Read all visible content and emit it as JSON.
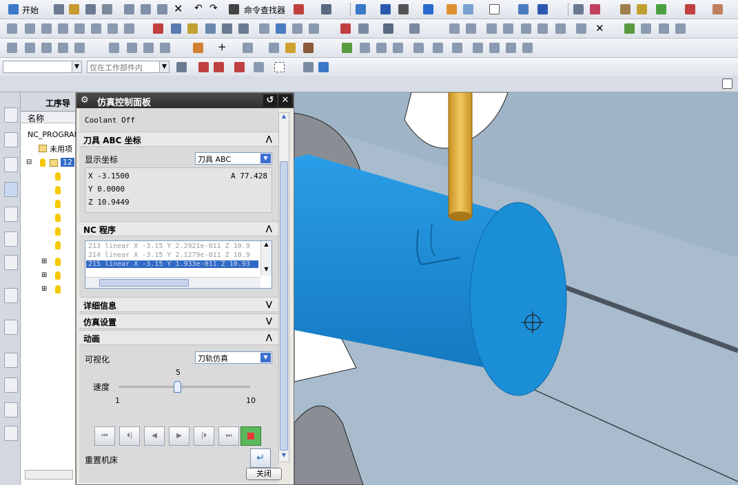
{
  "toolbar": {
    "start_label": "开始",
    "command_finder_label": "命令查找器"
  },
  "filters": {
    "filter_placeholder": "",
    "scope_label": "仅在工作部件内"
  },
  "navigator": {
    "title": "工序导",
    "column_name": "名称",
    "program_root": "NC_PROGRAM",
    "unused_item": "未用项",
    "program_item": "12"
  },
  "sim_panel": {
    "title": "仿真控制面板",
    "coolant_status": "Coolant Off",
    "tool_coords": {
      "header": "刀具 ABC 坐标",
      "display_label": "显示坐标",
      "display_value": "刀具 ABC",
      "x": "X -3.1500",
      "y": "Y 0.0000",
      "z": "Z 10.9449",
      "a": "A 77.428"
    },
    "nc_program": {
      "header": "NC 程序",
      "lines": [
        "213 linear X -3.15 Y 2.2921e-011 Z 10.9",
        "214 linear X -3.15 Y 2.1279e-011 Z 10.9",
        "215 linear X -3.15 Y 1.933e-011 Z 10.93"
      ],
      "selected_index": 2
    },
    "details_header": "详细信息",
    "sim_settings_header": "仿真设置",
    "animation": {
      "header": "动画",
      "visualize_label": "可视化",
      "visualize_value": "刀轨仿真",
      "speed_label": "速度",
      "speed_value": "5",
      "speed_min": "1",
      "speed_max": "10",
      "speed_fraction": 0.44,
      "reset_label": "重置机床"
    },
    "close_label": "关闭"
  },
  "colors": {
    "workpiece": "#1a8fd8",
    "tool": "#e0b040",
    "background": "#9fb4c6",
    "title_bar": "#2e2e2e"
  }
}
